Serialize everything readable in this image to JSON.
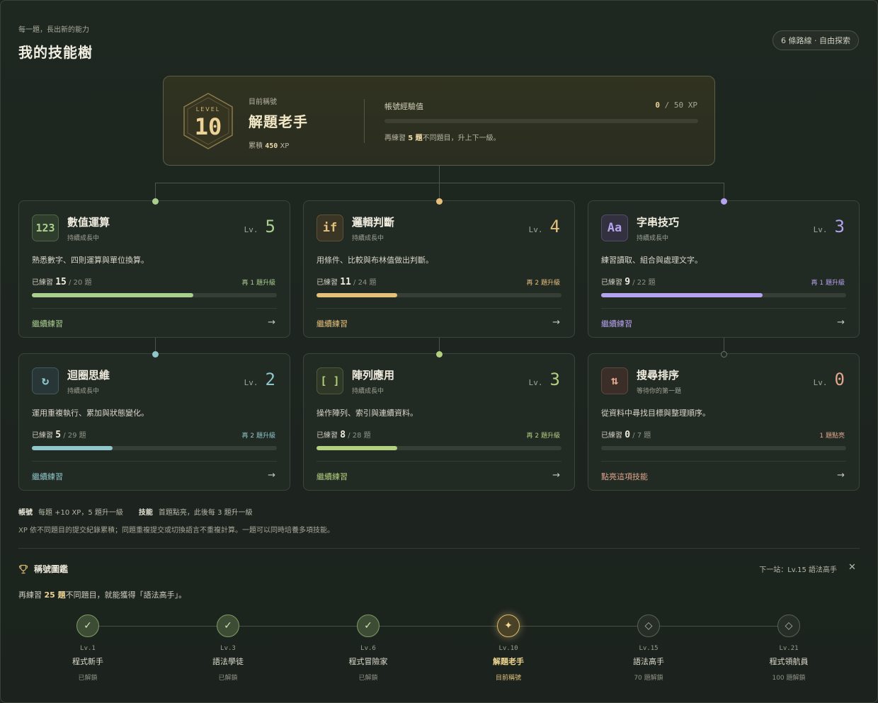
{
  "header": {
    "subtitle": "每一題，長出新的能力",
    "title": "我的技能樹",
    "routes": "6 條路線 · 自由探索"
  },
  "account": {
    "level_label": "LEVEL",
    "level": "10",
    "title_label": "目前稱號",
    "title": "解題老手",
    "total_prefix": "累積",
    "total_xp": "450",
    "total_unit": "XP",
    "xp_label": "帳號經驗值",
    "xp_current": "0",
    "xp_max": "/ 50 XP",
    "xp_progress": 0,
    "hint_prefix": "再練習",
    "hint_num": "5 題",
    "hint_suffix": "不同題目，升上下一級。"
  },
  "skills": [
    {
      "icon": "123",
      "icon_name": "numbers-icon",
      "name": "數值運算",
      "status": "持續成長中",
      "lv_label": "Lv.",
      "level": "5",
      "desc": "熟悉數字、四則運算與單位換算。",
      "prog_prefix": "已練習",
      "done": "15",
      "total": "/ 20 題",
      "next": "再 1 題升級",
      "progress": 0.66,
      "cta": "繼續練習",
      "color": "#a9cf8e",
      "icon_bg": "#2f3d2d",
      "icon_border": "#4f6646"
    },
    {
      "icon": "if",
      "icon_name": "logic-icon",
      "name": "邏輯判斷",
      "status": "持續成長中",
      "lv_label": "Lv.",
      "level": "4",
      "desc": "用條件、比較與布林值做出判斷。",
      "prog_prefix": "已練習",
      "done": "11",
      "total": "/ 24 題",
      "next": "再 2 題升級",
      "progress": 0.33,
      "cta": "繼續練習",
      "color": "#e5c07b",
      "icon_bg": "#3b3525",
      "icon_border": "#5e5233"
    },
    {
      "icon": "Aa",
      "icon_name": "string-icon",
      "name": "字串技巧",
      "status": "持續成長中",
      "lv_label": "Lv.",
      "level": "3",
      "desc": "練習讀取、組合與處理文字。",
      "prog_prefix": "已練習",
      "done": "9",
      "total": "/ 22 題",
      "next": "再 1 題升級",
      "progress": 0.66,
      "cta": "繼續練習",
      "color": "#b6a3ef",
      "icon_bg": "#33303f",
      "icon_border": "#524a6b"
    },
    {
      "icon": "↻",
      "icon_name": "loop-icon",
      "name": "迴圈思維",
      "status": "持續成長中",
      "lv_label": "Lv.",
      "level": "2",
      "desc": "運用重複執行、累加與狀態變化。",
      "prog_prefix": "已練習",
      "done": "5",
      "total": "/ 29 題",
      "next": "再 2 題升級",
      "progress": 0.33,
      "cta": "繼續練習",
      "color": "#8fc6c9",
      "icon_bg": "#283637",
      "icon_border": "#41595a"
    },
    {
      "icon": "[ ]",
      "icon_name": "array-icon",
      "name": "陣列應用",
      "status": "持續成長中",
      "lv_label": "Lv.",
      "level": "3",
      "desc": "操作陣列、索引與連續資料。",
      "prog_prefix": "已練習",
      "done": "8",
      "total": "/ 28 題",
      "next": "再 2 題升級",
      "progress": 0.33,
      "cta": "繼續練習",
      "color": "#b3d07f",
      "icon_bg": "#2f3826",
      "icon_border": "#4d5b3b"
    },
    {
      "icon": "⇅",
      "icon_name": "sort-icon",
      "name": "搜尋排序",
      "status": "等待你的第一題",
      "lv_label": "Lv.",
      "level": "0",
      "desc": "從資料中尋找目標與整理順序。",
      "prog_prefix": "已練習",
      "done": "0",
      "total": "/ 7 題",
      "next": "1 題點亮",
      "progress": 0,
      "cta": "點亮這項技能",
      "color": "#e0a68c",
      "icon_bg": "#3b2d28",
      "icon_border": "#5e463c"
    }
  ],
  "rules": {
    "account_label": "帳號",
    "account_rule": "每題 +10 XP，5 題升一級",
    "skill_label": "技能",
    "skill_rule": "首題點亮，此後每 3 題升一級",
    "note": "XP 依不同題目的提交紀錄累積；同題重複提交或切換語言不重複計算。一題可以同時培養多項技能。"
  },
  "titles": {
    "heading": "稱號圖鑑",
    "next_stop": "下一站：Lv.15 語法高手",
    "hint_prefix": "再練習",
    "hint_num": "25 題",
    "hint_suffix": "不同題目，就能獲得「語法高手」。",
    "milestones": [
      {
        "lv": "Lv.1",
        "name": "程式新手",
        "state": "已解鎖",
        "kind": "done",
        "icon_name": "check-icon"
      },
      {
        "lv": "Lv.3",
        "name": "語法學徒",
        "state": "已解鎖",
        "kind": "done",
        "icon_name": "check-icon"
      },
      {
        "lv": "Lv.6",
        "name": "程式冒險家",
        "state": "已解鎖",
        "kind": "done",
        "icon_name": "check-icon"
      },
      {
        "lv": "Lv.10",
        "name": "解題老手",
        "state": "目前稱號",
        "kind": "current",
        "icon_name": "sparkle-icon"
      },
      {
        "lv": "Lv.15",
        "name": "語法高手",
        "state": "70 題解鎖",
        "kind": "locked",
        "icon_name": "diamond-icon"
      },
      {
        "lv": "Lv.21",
        "name": "程式領航員",
        "state": "100 題解鎖",
        "kind": "locked",
        "icon_name": "diamond-icon"
      }
    ]
  }
}
